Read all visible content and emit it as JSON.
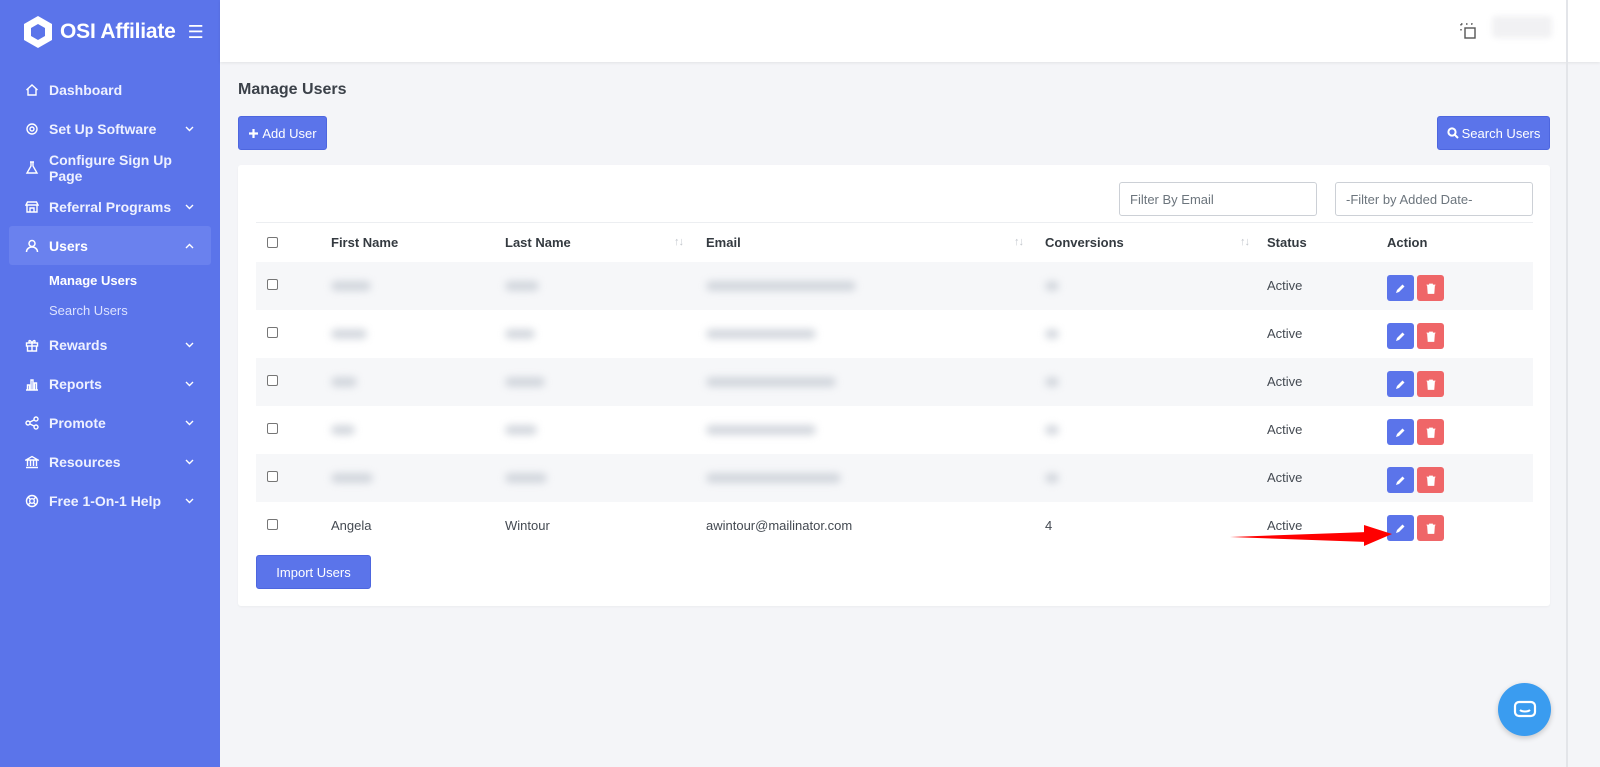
{
  "app": {
    "name": "OSI Affiliate"
  },
  "sidebar": {
    "items": [
      {
        "label": "Dashboard",
        "icon": "home-icon",
        "chevron": ""
      },
      {
        "label": "Set Up Software",
        "icon": "gear-icon",
        "chevron": "down"
      },
      {
        "label": "Configure Sign Up Page",
        "icon": "flask-icon",
        "chevron": ""
      },
      {
        "label": "Referral Programs",
        "icon": "store-icon",
        "chevron": "down"
      },
      {
        "label": "Users",
        "icon": "user-icon",
        "chevron": "up",
        "active": true
      },
      {
        "label": "Rewards",
        "icon": "gift-icon",
        "chevron": "down"
      },
      {
        "label": "Reports",
        "icon": "bar-chart-icon",
        "chevron": "down"
      },
      {
        "label": "Promote",
        "icon": "share-icon",
        "chevron": "down"
      },
      {
        "label": "Resources",
        "icon": "bank-icon",
        "chevron": "down"
      },
      {
        "label": "Free 1-On-1 Help",
        "icon": "lifebuoy-icon",
        "chevron": "down"
      }
    ],
    "sub_items": [
      {
        "label": "Manage Users",
        "active": true
      },
      {
        "label": "Search Users",
        "active": false
      }
    ]
  },
  "main": {
    "title": "Manage Users",
    "add_button": "Add User",
    "search_button": "Search Users",
    "import_button": "Import Users",
    "filters": {
      "email_placeholder": "Filter By Email",
      "date_placeholder": "-Filter by Added Date-"
    },
    "columns": [
      "First Name",
      "Last Name",
      "Email",
      "Conversions",
      "Status",
      "Action"
    ],
    "rows": [
      {
        "first_name": "",
        "last_name": "",
        "email": "",
        "conversions": "",
        "status": "Active",
        "blurred": true
      },
      {
        "first_name": "",
        "last_name": "",
        "email": "",
        "conversions": "",
        "status": "Active",
        "blurred": true
      },
      {
        "first_name": "",
        "last_name": "",
        "email": "",
        "conversions": "",
        "status": "Active",
        "blurred": true
      },
      {
        "first_name": "",
        "last_name": "",
        "email": "",
        "conversions": "",
        "status": "Active",
        "blurred": true
      },
      {
        "first_name": "",
        "last_name": "",
        "email": "",
        "conversions": "",
        "status": "Active",
        "blurred": true
      },
      {
        "first_name": "Angela",
        "last_name": "Wintour",
        "email": "awintour@mailinator.com",
        "conversions": "4",
        "status": "Active",
        "blurred": false
      }
    ]
  },
  "colors": {
    "sidebar": "#5b74ea",
    "primary": "#5b74ea",
    "danger": "#ef6668",
    "chat": "#3a9cf0",
    "annotation_arrow": "#ff0000"
  }
}
